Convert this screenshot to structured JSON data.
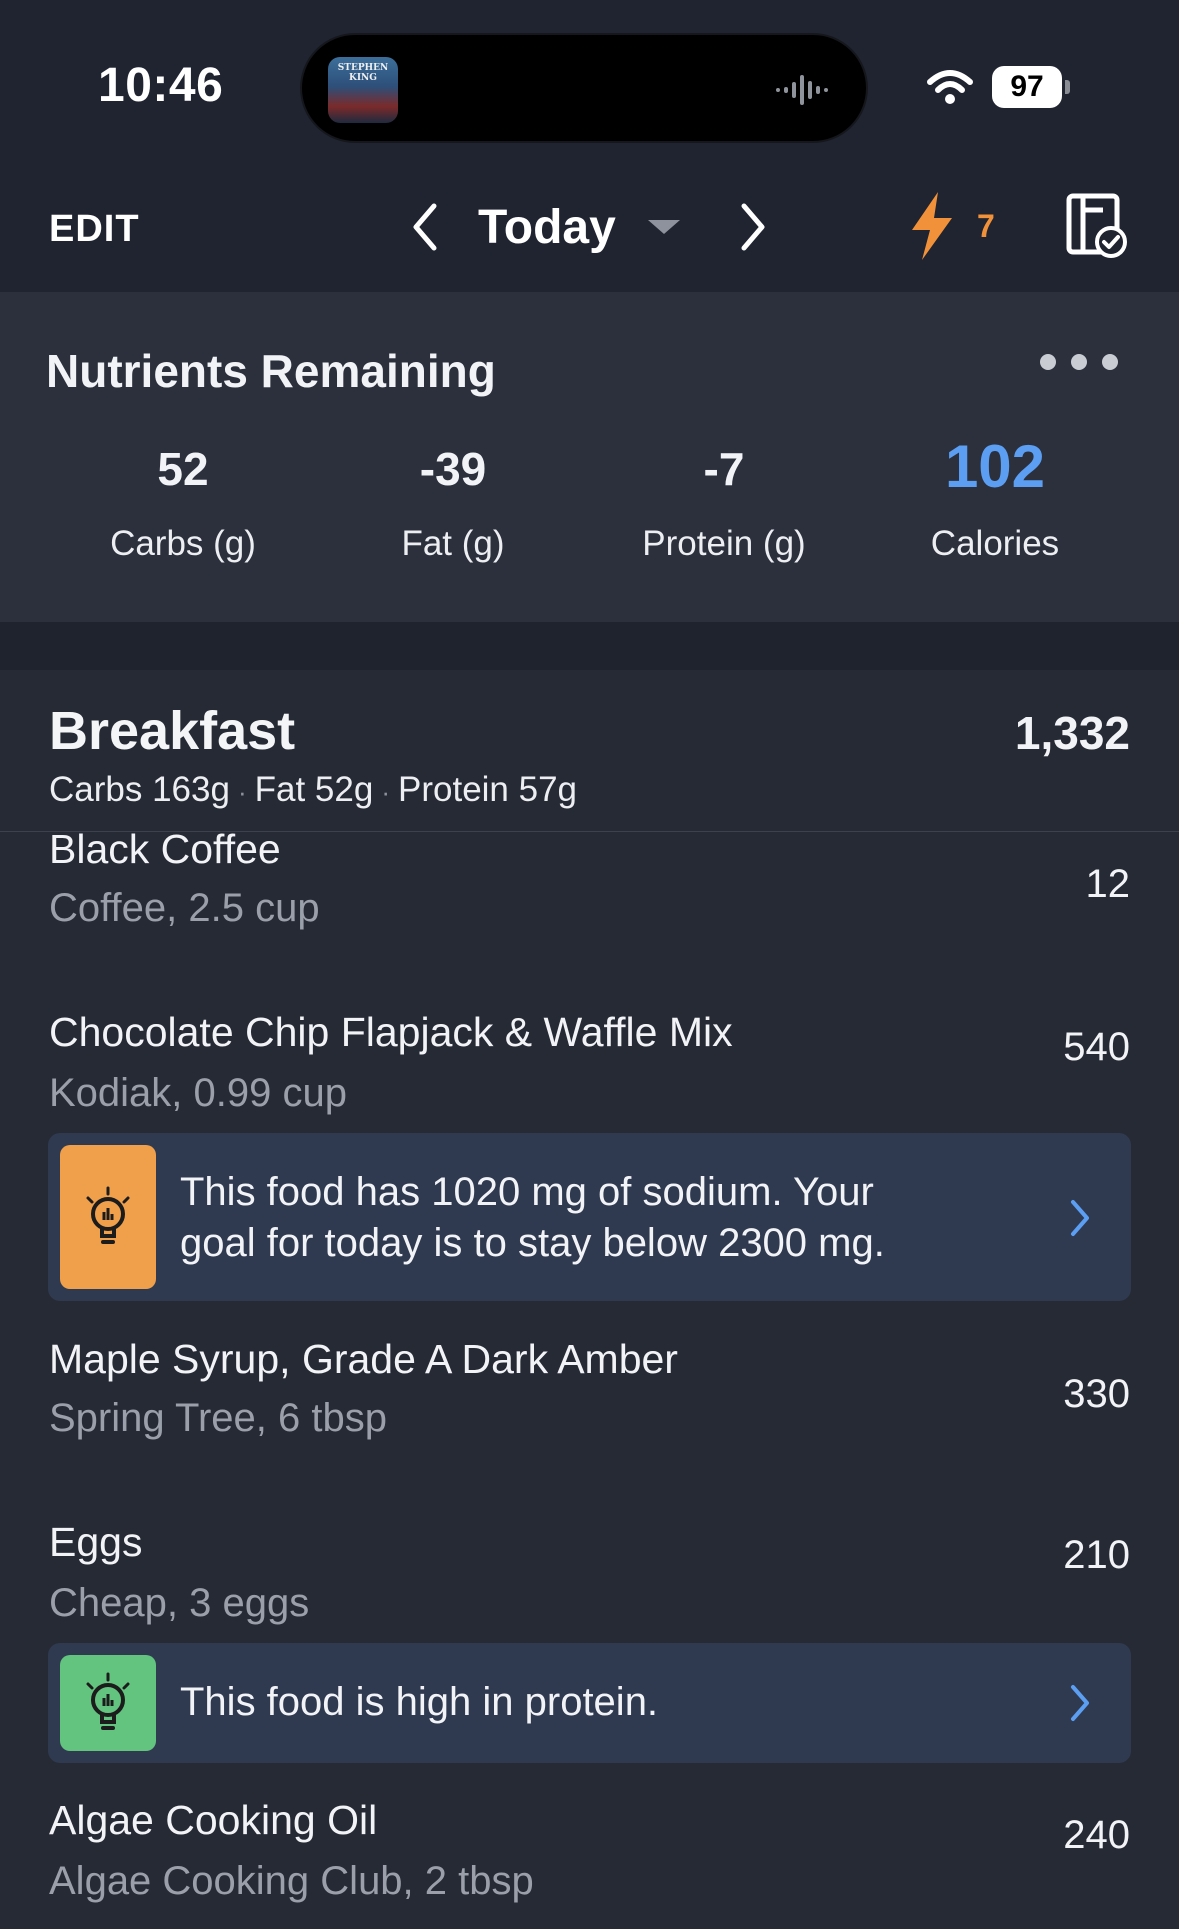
{
  "status_bar": {
    "time": "10:46",
    "now_playing_art_text": "STEPHEN KING",
    "battery": "97"
  },
  "header": {
    "edit_label": "EDIT",
    "date_label": "Today",
    "streak_count": "7",
    "icons": [
      "chevron-left-icon",
      "caret-down-icon",
      "chevron-right-icon",
      "lightning-icon",
      "food-log-check-icon"
    ]
  },
  "nutrients": {
    "title": "Nutrients Remaining",
    "items": [
      {
        "value": "52",
        "label": "Carbs (g)"
      },
      {
        "value": "-39",
        "label": "Fat (g)"
      },
      {
        "value": "-7",
        "label": "Protein (g)"
      },
      {
        "value": "102",
        "label": "Calories"
      }
    ]
  },
  "meal": {
    "name": "Breakfast",
    "total": "1,332",
    "macros": {
      "carbs": "Carbs 163g",
      "fat": "Fat 52g",
      "protein": "Protein 57g",
      "separator": "·"
    },
    "foods": [
      {
        "name": "Black Coffee",
        "detail": "Coffee, 2.5 cup",
        "calories": "12"
      },
      {
        "name": "Chocolate Chip Flapjack & Waffle Mix",
        "detail": "Kodiak, 0.99 cup",
        "calories": "540"
      },
      {
        "name": "Maple Syrup, Grade A Dark Amber",
        "detail": "Spring Tree, 6 tbsp",
        "calories": "330"
      },
      {
        "name": "Eggs",
        "detail": "Cheap, 3 eggs",
        "calories": "210"
      },
      {
        "name": "Algae Cooking Oil",
        "detail": "Algae Cooking Club, 2 tbsp",
        "calories": "240"
      }
    ],
    "insights": [
      {
        "line1": "This food has 1020 mg of sodium. Your",
        "line2": "goal for today is to stay below 2300 mg.",
        "icon_color": "#f0a04b"
      },
      {
        "line1": "This food is high in protein.",
        "line2": "",
        "icon_color": "#62c47f"
      }
    ]
  },
  "colors": {
    "background": "#262a35",
    "header_bg": "#1f2430",
    "card_bg": "#2b303c",
    "insight_bg": "#2f3a50",
    "accent_blue": "#5b9ef2",
    "streak_orange": "#f1923a"
  }
}
